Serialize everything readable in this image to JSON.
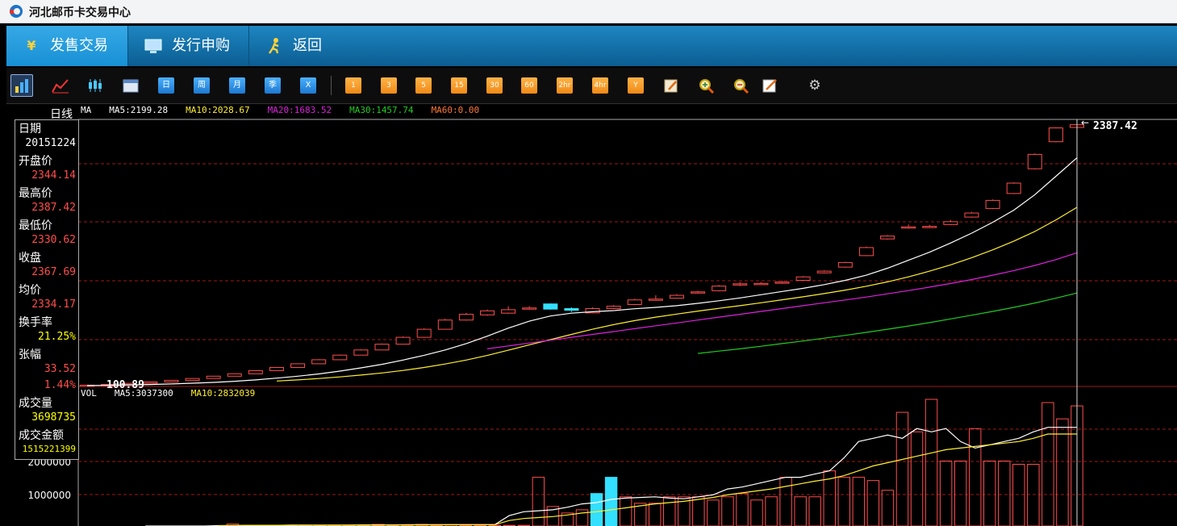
{
  "window": {
    "title": "河北邮币卡交易中心"
  },
  "nav": {
    "tabs": [
      {
        "label": "发售交易",
        "icon": "yen-icon",
        "active": true
      },
      {
        "label": "发行申购",
        "icon": "monitor-icon",
        "active": false
      },
      {
        "label": "返回",
        "icon": "runner-icon",
        "active": false
      }
    ]
  },
  "toolbar": {
    "period_buttons": [
      "日",
      "周",
      "月",
      "季",
      "X"
    ],
    "minute_buttons": [
      "1",
      "3",
      "5",
      "15",
      "30",
      "60",
      "2hr",
      "4hr",
      "Y"
    ],
    "icons": [
      "bar-chart-icon",
      "line-chart-icon",
      "candlestick-icon",
      "calendar-icon",
      "edit-icon",
      "zoom-in-icon",
      "zoom-out-icon",
      "draw-icon",
      "settings-icon"
    ]
  },
  "chart_labels": {
    "period": "日线",
    "ma_prefix": "MA",
    "ma5": "MA5:2199.28",
    "ma10": "MA10:2028.67",
    "ma20": "MA20:1683.52",
    "ma30": "MA30:1457.74",
    "ma60": "MA60:0.00",
    "vol_prefix": "VOL",
    "vol_ma5": "MA5:3037300",
    "vol_ma10": "MA10:2832039",
    "max_label": "2387.42",
    "min_label": "100.89"
  },
  "info": {
    "date_label": "日期",
    "date": "20151224",
    "open_label": "开盘价",
    "open": "2344.14",
    "high_label": "最高价",
    "high": "2387.42",
    "low_label": "最低价",
    "low": "2330.62",
    "close_label": "收盘",
    "close": "2367.69",
    "avg_label": "均价",
    "avg": "2334.17",
    "turnover_label": "换手率",
    "turnover": "21.25%",
    "change_label": "张幅",
    "change": "33.52",
    "change_pct": "1.44%",
    "volume_label": "成交量",
    "volume": "3698735",
    "amount_label": "成交金额",
    "amount": "1515221399"
  },
  "colors": {
    "up": "#ff4d4d",
    "down": "#33e0ff",
    "ma5": "#ffffff",
    "ma10": "#ffee33",
    "ma20": "#dd22dd",
    "ma30": "#22cc22",
    "ma60": "#ff7733",
    "grid": "#a01818"
  },
  "chart_data": {
    "type": "candlestick",
    "price_axis": {
      "ylim": [
        100,
        2400
      ]
    },
    "volume_axis": {
      "ticks": [
        "2000000",
        "1000000"
      ],
      "ylim": [
        0,
        3900000
      ]
    },
    "candles": [
      {
        "o": 100.9,
        "c": 104,
        "h": 104,
        "l": 100.9
      },
      {
        "o": 104,
        "c": 111,
        "h": 112,
        "l": 102
      },
      {
        "o": 111,
        "c": 120,
        "h": 122,
        "l": 110
      },
      {
        "o": 120,
        "c": 132,
        "h": 134,
        "l": 119
      },
      {
        "o": 132,
        "c": 146,
        "h": 148,
        "l": 131
      },
      {
        "o": 146,
        "c": 162,
        "h": 165,
        "l": 145
      },
      {
        "o": 162,
        "c": 182,
        "h": 185,
        "l": 161
      },
      {
        "o": 182,
        "c": 203,
        "h": 206,
        "l": 181
      },
      {
        "o": 203,
        "c": 230,
        "h": 233,
        "l": 202
      },
      {
        "o": 230,
        "c": 258,
        "h": 262,
        "l": 229
      },
      {
        "o": 258,
        "c": 290,
        "h": 294,
        "l": 257
      },
      {
        "o": 290,
        "c": 325,
        "h": 330,
        "l": 289
      },
      {
        "o": 325,
        "c": 365,
        "h": 370,
        "l": 324
      },
      {
        "o": 365,
        "c": 410,
        "h": 416,
        "l": 364
      },
      {
        "o": 410,
        "c": 460,
        "h": 466,
        "l": 409
      },
      {
        "o": 460,
        "c": 520,
        "h": 527,
        "l": 459
      },
      {
        "o": 520,
        "c": 590,
        "h": 598,
        "l": 519
      },
      {
        "o": 590,
        "c": 670,
        "h": 680,
        "l": 589
      },
      {
        "o": 670,
        "c": 720,
        "h": 732,
        "l": 665
      },
      {
        "o": 715,
        "c": 750,
        "h": 762,
        "l": 708
      },
      {
        "o": 730,
        "c": 760,
        "h": 790,
        "l": 725
      },
      {
        "o": 770,
        "c": 775,
        "h": 790,
        "l": 760
      },
      {
        "o": 810,
        "c": 765,
        "h": 815,
        "l": 760
      },
      {
        "o": 770,
        "c": 755,
        "h": 780,
        "l": 740
      },
      {
        "o": 732,
        "c": 770,
        "h": 780,
        "l": 728
      },
      {
        "o": 770,
        "c": 790,
        "h": 800,
        "l": 765
      },
      {
        "o": 805,
        "c": 845,
        "h": 855,
        "l": 800
      },
      {
        "o": 845,
        "c": 852,
        "h": 885,
        "l": 840
      },
      {
        "o": 860,
        "c": 885,
        "h": 895,
        "l": 855
      },
      {
        "o": 905,
        "c": 915,
        "h": 925,
        "l": 900
      },
      {
        "o": 925,
        "c": 965,
        "h": 975,
        "l": 920
      },
      {
        "o": 975,
        "c": 985,
        "h": 1000,
        "l": 965
      },
      {
        "o": 980,
        "c": 988,
        "h": 1000,
        "l": 975
      },
      {
        "o": 990,
        "c": 1000,
        "h": 1008,
        "l": 985
      },
      {
        "o": 1015,
        "c": 1045,
        "h": 1052,
        "l": 1010
      },
      {
        "o": 1080,
        "c": 1095,
        "h": 1102,
        "l": 1075
      },
      {
        "o": 1130,
        "c": 1170,
        "h": 1176,
        "l": 1125
      },
      {
        "o": 1230,
        "c": 1300,
        "h": 1308,
        "l": 1225
      },
      {
        "o": 1375,
        "c": 1400,
        "h": 1408,
        "l": 1370
      },
      {
        "o": 1470,
        "c": 1480,
        "h": 1500,
        "l": 1465
      },
      {
        "o": 1475,
        "c": 1484,
        "h": 1496,
        "l": 1470
      },
      {
        "o": 1500,
        "c": 1525,
        "h": 1540,
        "l": 1495
      },
      {
        "o": 1565,
        "c": 1600,
        "h": 1610,
        "l": 1560
      },
      {
        "o": 1640,
        "c": 1710,
        "h": 1718,
        "l": 1635
      },
      {
        "o": 1770,
        "c": 1860,
        "h": 1868,
        "l": 1765
      },
      {
        "o": 1985,
        "c": 2110,
        "h": 2118,
        "l": 1980
      },
      {
        "o": 2220,
        "c": 2340,
        "h": 2345,
        "l": 2215
      },
      {
        "o": 2344.14,
        "c": 2367.69,
        "h": 2387.42,
        "l": 2330.62
      }
    ],
    "volume": [
      4000,
      15000,
      15000,
      15000,
      15000,
      15000,
      15000,
      15000,
      15000,
      15000,
      80000,
      15000,
      15000,
      15000,
      15000,
      15000,
      15000,
      15000,
      15000,
      15000,
      15000,
      15000,
      15000,
      15000,
      15000,
      15000,
      15000,
      15000,
      15000,
      15000,
      15000,
      15000,
      15000,
      15000,
      15000,
      15000,
      15000,
      15000,
      15000,
      15000,
      15000,
      15000,
      15000,
      15000,
      15000,
      15000,
      15000,
      15000
    ],
    "ma5": [
      101,
      103,
      106,
      110,
      115,
      121,
      128,
      138,
      150,
      165,
      182,
      202,
      226,
      254,
      285,
      322,
      364,
      410,
      465,
      530,
      600,
      660,
      705,
      730,
      742,
      752,
      768,
      780,
      795,
      815,
      838,
      862,
      890,
      918,
      946,
      978,
      1015,
      1060,
      1120,
      1190,
      1260,
      1340,
      1425,
      1520,
      1625,
      1760,
      1920,
      2080
    ],
    "ma10": [
      null,
      null,
      null,
      null,
      null,
      null,
      null,
      null,
      null,
      140,
      150,
      162,
      176,
      192,
      210,
      232,
      258,
      288,
      322,
      362,
      408,
      455,
      500,
      545,
      590,
      630,
      665,
      695,
      722,
      748,
      772,
      795,
      820,
      846,
      872,
      900,
      930,
      964,
      1002,
      1045,
      1095,
      1150,
      1212,
      1280,
      1356,
      1440,
      1540,
      1650
    ],
    "ma20": [
      null,
      null,
      null,
      null,
      null,
      null,
      null,
      null,
      null,
      null,
      null,
      null,
      null,
      null,
      null,
      null,
      null,
      null,
      null,
      420,
      445,
      470,
      495,
      520,
      545,
      570,
      595,
      620,
      645,
      670,
      695,
      720,
      745,
      770,
      795,
      820,
      845,
      870,
      898,
      926,
      956,
      988,
      1022,
      1060,
      1100,
      1145,
      1195,
      1255
    ],
    "ma30": [
      null,
      null,
      null,
      null,
      null,
      null,
      null,
      null,
      null,
      null,
      null,
      null,
      null,
      null,
      null,
      null,
      null,
      null,
      null,
      null,
      null,
      null,
      null,
      null,
      null,
      null,
      null,
      null,
      null,
      380,
      400,
      420,
      442,
      465,
      488,
      512,
      537,
      563,
      590,
      618,
      648,
      680,
      712,
      745,
      780,
      818,
      860,
      905
    ],
    "vol_bars": [
      0,
      0,
      0,
      0,
      0,
      0,
      0,
      0,
      0,
      0,
      60000,
      20000,
      20000,
      20000,
      20000,
      20000,
      20000,
      20000,
      20000,
      20000,
      50000,
      20000,
      20000,
      50000,
      20000,
      40000,
      20000,
      20000,
      20000,
      20000,
      20000,
      1500000,
      600000,
      400000,
      500000,
      1000000,
      1500000,
      900000,
      700000,
      700000,
      900000,
      900000,
      900000,
      800000,
      900000,
      1000000,
      800000,
      900000,
      1500000,
      900000,
      900000,
      1700000,
      1500000,
      1500000,
      1400000,
      1100000,
      3500000,
      2900000,
      3900000,
      2000000,
      2000000,
      3000000,
      2000000,
      2000000,
      1900000,
      1900000,
      3800000,
      3300000,
      3698735
    ],
    "vol_up": true,
    "vol_ma5": [
      null,
      null,
      null,
      null,
      0,
      0,
      0,
      0,
      0,
      12000,
      16000,
      20000,
      20000,
      20000,
      28000,
      28000,
      30000,
      30000,
      30000,
      36000,
      36000,
      36000,
      40000,
      40000,
      40000,
      40000,
      40000,
      40000,
      40000,
      320000,
      440000,
      470000,
      500000,
      580000,
      680000,
      720000,
      820000,
      860000,
      880000,
      900000,
      860000,
      840000,
      900000,
      960000,
      1140000,
      1200000,
      1300000,
      1400000,
      1500000,
      1500000,
      1600000,
      1700000,
      2100000,
      2600000,
      2700000,
      2800000,
      2700000,
      3000000,
      2900000,
      3000000,
      2600000,
      2400000,
      2500000,
      2600000,
      2700000,
      2900000,
      3037300,
      3037300,
      3037300
    ],
    "vol_ma10": [
      null,
      null,
      null,
      null,
      null,
      null,
      null,
      null,
      null,
      8000,
      10000,
      12000,
      14000,
      16000,
      18000,
      20000,
      22000,
      24000,
      26000,
      28000,
      30000,
      32000,
      34000,
      36000,
      38000,
      40000,
      40000,
      40000,
      40000,
      170000,
      230000,
      260000,
      290000,
      340000,
      400000,
      440000,
      500000,
      560000,
      620000,
      680000,
      720000,
      760000,
      820000,
      880000,
      960000,
      1020000,
      1080000,
      1140000,
      1220000,
      1300000,
      1380000,
      1450000,
      1550000,
      1700000,
      1850000,
      1950000,
      2050000,
      2150000,
      2250000,
      2350000,
      2400000,
      2450000,
      2500000,
      2550000,
      2600000,
      2700000,
      2832039,
      2832039,
      2832039
    ]
  }
}
